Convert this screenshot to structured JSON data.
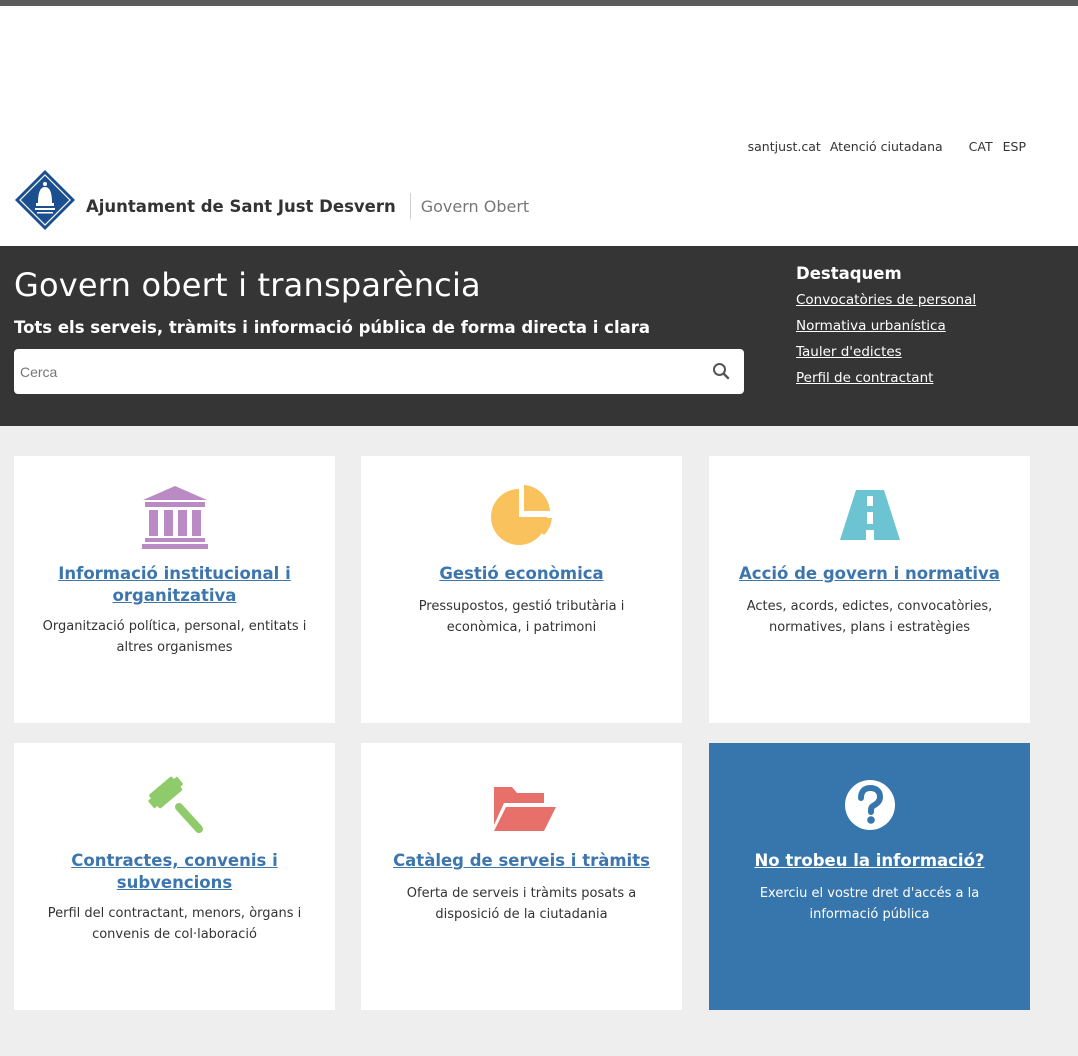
{
  "util_nav": {
    "site_link": "santjust.cat",
    "citizen_link": "Atenció ciutadana",
    "lang_cat": "CAT",
    "lang_esp": "ESP"
  },
  "brand": {
    "org_name": "Ajuntament de Sant Just Desvern",
    "section": "Govern Obert"
  },
  "hero": {
    "title": "Govern obert i transparència",
    "tagline": "Tots els serveis, tràmits i informació pública de forma directa i clara",
    "search_placeholder": "Cerca",
    "search_value": ""
  },
  "highlights": {
    "title": "Destaquem",
    "links": [
      "Convocatòries de personal",
      "Normativa urbanística",
      "Tauler d'edictes",
      "Perfil de contractant"
    ]
  },
  "cards": [
    {
      "title": "Informació institucional i organitzativa",
      "desc": "Organització política, personal, entitats i altres organismes",
      "icon": "institution-building-icon",
      "icon_color": "#b98ac4"
    },
    {
      "title": "Gestió econòmica",
      "desc": "Pressupostos, gestió tributària i econòmica, i patrimoni",
      "icon": "pie-chart-icon",
      "icon_color": "#f9c25c"
    },
    {
      "title": "Acció de govern i normativa",
      "desc": "Actes, acords, edictes, convocatòries, normatives, plans i estratègies",
      "icon": "road-icon",
      "icon_color": "#6cc4d2"
    },
    {
      "title": "Contractes, convenis i subvencions",
      "desc": "Perfil del contractant, menors, òrgans i convenis de col·laboració",
      "icon": "gavel-icon",
      "icon_color": "#8fcb6a"
    },
    {
      "title": "Catàleg de serveis i tràmits",
      "desc": "Oferta de serveis i tràmits posats a disposició de la ciutadania",
      "icon": "folder-open-icon",
      "icon_color": "#e8706a"
    },
    {
      "title": "No trobeu la informació?",
      "desc": "Exerciu el vostre dret d'accés a la informació pública",
      "icon": "question-circle-icon",
      "icon_color": "#ffffff"
    }
  ],
  "colors": {
    "hero_bg": "#353535",
    "link_blue": "#3d76ad",
    "info_card_bg": "#3676ad",
    "grid_bg": "#eeeeee",
    "logo_blue": "#1b4f8f"
  }
}
